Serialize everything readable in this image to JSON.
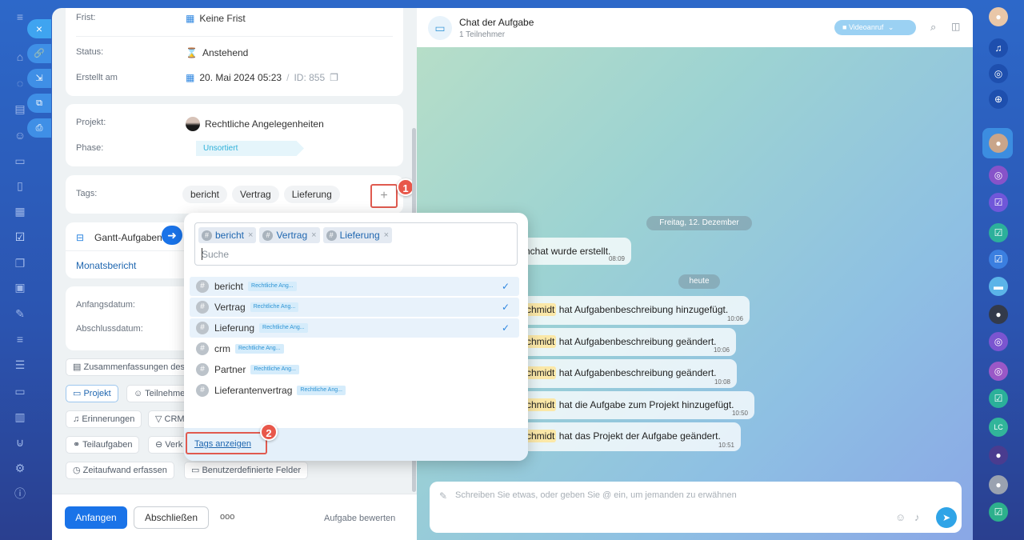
{
  "task": {
    "deadline_label": "Frist:",
    "deadline_value": "Keine Frist",
    "status_label": "Status:",
    "status_value": "Anstehend",
    "created_label": "Erstellt am",
    "created_value": "20. Mai 2024 05:23",
    "id_sep": "/",
    "id_value": "ID: 855",
    "project_label": "Projekt:",
    "project_value": "Rechtliche Angelegenheiten",
    "phase_label": "Phase:",
    "phase_value": "Unsortiert",
    "tags_label": "Tags:",
    "tags": [
      "bericht",
      "Vertrag",
      "Lieferung"
    ],
    "gantt_label": "Gantt-Aufgaben",
    "gantt_link": "Monatsbericht",
    "start_label": "Anfangsdatum:",
    "end_label": "Abschlussdatum:",
    "actions": {
      "summaries": "Zusammenfassungen des",
      "project": "Projekt",
      "participants": "Teilnehmer",
      "reminders": "Erinnerungen",
      "crm": "CRM",
      "subtasks": "Teilaufgaben",
      "links": "Verk",
      "time_tracking": "Zeitaufwand erfassen",
      "custom_fields": "Benutzerdefinierte Felder"
    },
    "buttons": {
      "start": "Anfangen",
      "finish": "Abschließen",
      "more": "ooo",
      "rate": "Aufgabe bewerten"
    }
  },
  "popup": {
    "selected": [
      "bericht",
      "Vertrag",
      "Lieferung"
    ],
    "search_placeholder": "Suche",
    "options": [
      {
        "name": "bericht",
        "project": "Rechtliche Ang...",
        "selected": true
      },
      {
        "name": "Vertrag",
        "project": "Rechtliche Ang...",
        "selected": true
      },
      {
        "name": "Lieferung",
        "project": "Rechtliche Ang...",
        "selected": true
      },
      {
        "name": "crm",
        "project": "Rechtliche Ang...",
        "selected": false
      },
      {
        "name": "Partner",
        "project": "Rechtliche Ang...",
        "selected": false
      },
      {
        "name": "Lieferantenvertrag",
        "project": "Rechtliche Ang...",
        "selected": false
      }
    ],
    "show_tags": "Tags anzeigen"
  },
  "annotations": {
    "badge1": "1",
    "badge2": "2"
  },
  "chat": {
    "title": "Chat der Aufgabe",
    "subtitle": "1 Teilnehmer",
    "video_call": "Videoanruf",
    "date1": "Freitag, 12. Dezember",
    "created_msg": "nchat wurde erstellt.",
    "created_time": "08:09",
    "date2": "heute",
    "messages": [
      {
        "user": "chmidt",
        "text": "hat Aufgabenbeschreibung hinzugefügt.",
        "time": "10:06"
      },
      {
        "user": "chmidt",
        "text": "hat Aufgabenbeschreibung geändert.",
        "time": "10:06"
      },
      {
        "user": "chmidt",
        "text": "hat Aufgabenbeschreibung geändert.",
        "time": "10:08"
      },
      {
        "user": "chmidt",
        "text": "hat die Aufgabe zum Projekt hinzugefügt.",
        "time": "10:50"
      },
      {
        "user": "chmidt",
        "text": "hat das Projekt der Aufgabe geändert.",
        "time": "10:51"
      }
    ],
    "input_placeholder": "Schreiben Sie etwas, oder geben Sie @ ein, um jemanden zu erwähnen"
  },
  "right_rail": {
    "lc_badge": "LC"
  },
  "colors": {
    "accent": "#2d86e0",
    "highlight": "#e8574a",
    "primary_button": "#1a73e8"
  }
}
